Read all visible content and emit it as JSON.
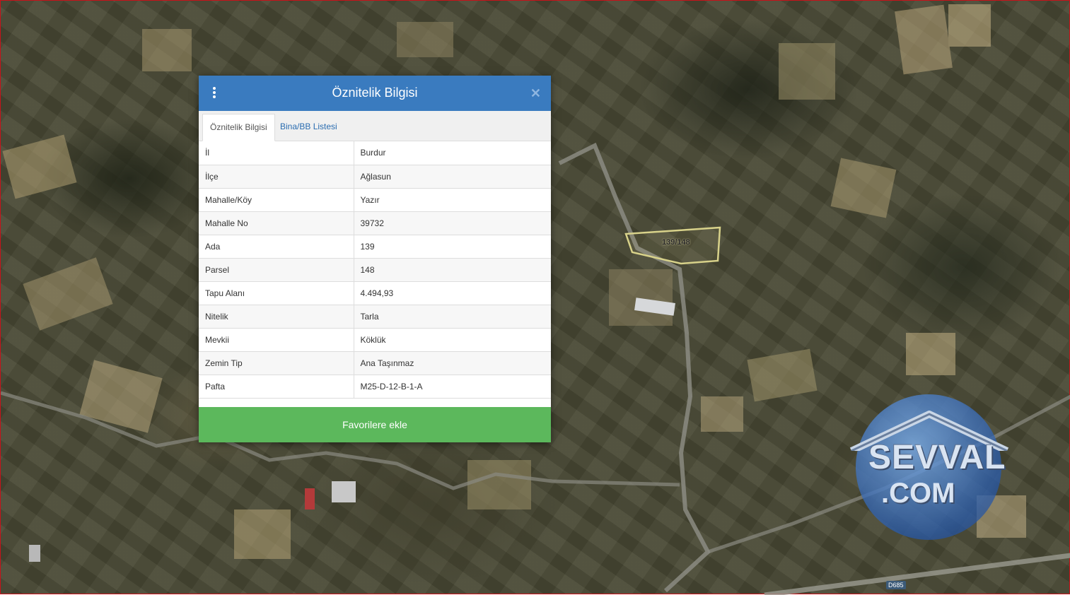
{
  "dialog": {
    "title": "Öznitelik Bilgisi",
    "tabs": [
      {
        "label": "Öznitelik Bilgisi",
        "active": true
      },
      {
        "label": "Bina/BB Listesi",
        "active": false
      }
    ],
    "rows": [
      {
        "key": "İl",
        "value": "Burdur"
      },
      {
        "key": "İlçe",
        "value": "Ağlasun"
      },
      {
        "key": "Mahalle/Köy",
        "value": "Yazır"
      },
      {
        "key": "Mahalle No",
        "value": "39732"
      },
      {
        "key": "Ada",
        "value": "139"
      },
      {
        "key": "Parsel",
        "value": "148"
      },
      {
        "key": "Tapu Alanı",
        "value": "4.494,93"
      },
      {
        "key": "Nitelik",
        "value": "Tarla"
      },
      {
        "key": "Mevkii",
        "value": "Köklük"
      },
      {
        "key": "Zemin Tip",
        "value": "Ana Taşınmaz"
      },
      {
        "key": "Pafta",
        "value": "M25-D-12-B-1-A"
      }
    ],
    "favorite_label": "Favorilere ekle",
    "close_symbol": "✕",
    "header_color": "#3a7bbf",
    "button_color": "#5cb85c"
  },
  "map": {
    "parcel_label": "139/148",
    "road_badge": "D685",
    "parcel_outline_color": "#d8d28a"
  },
  "watermark": {
    "line1": "SEVVAL",
    "line2": ".COM"
  },
  "icons": {
    "menu": "kebab-menu-icon",
    "close": "close-icon"
  }
}
